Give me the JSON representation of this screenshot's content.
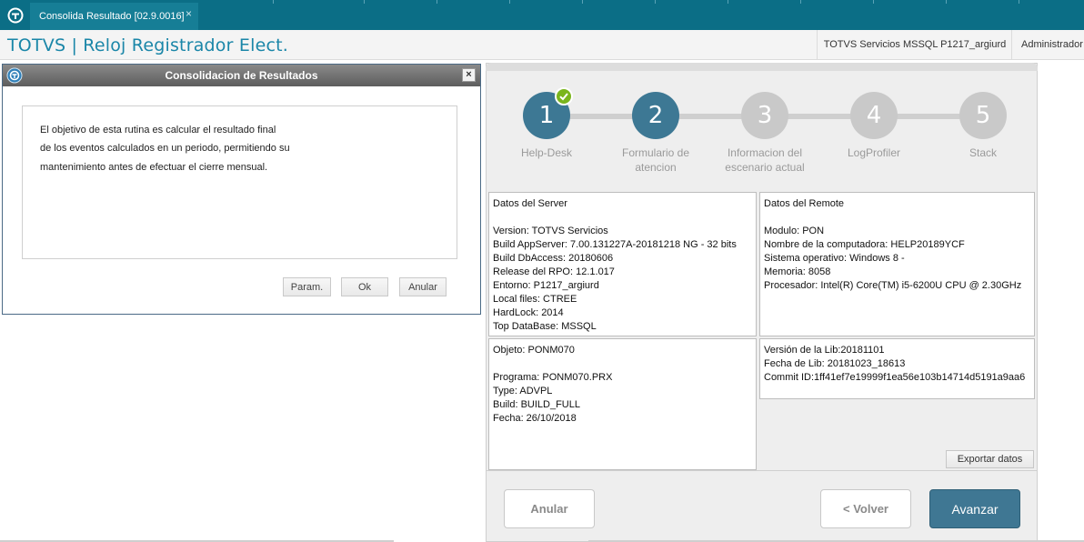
{
  "tab": {
    "title": "Consolida Resultado [02.9.0016]",
    "close": "×"
  },
  "header": {
    "app_title": "TOTVS | Reloj Registrador Elect.",
    "server": "TOTVS Servicios MSSQL P1217_argiurd",
    "user": "Administrador"
  },
  "dialog": {
    "title": "Consolidacion de Resultados",
    "close": "×",
    "lines": [
      "El objetivo de esta rutina es calcular el resultado final",
      "de los eventos calculados en un periodo,  permitiendo su",
      "mantenimiento antes de efectuar el cierre mensual."
    ],
    "buttons": {
      "param": "Param.",
      "ok": "Ok",
      "cancel": "Anular"
    }
  },
  "wizard": {
    "steps": [
      {
        "num": "1",
        "label": "Help-Desk",
        "label2": "",
        "state": "done"
      },
      {
        "num": "2",
        "label": "Formulario de",
        "label2": "atencion",
        "state": "done"
      },
      {
        "num": "3",
        "label": "Informacion del",
        "label2": "escenario actual",
        "state": "todo"
      },
      {
        "num": "4",
        "label": "LogProfiler",
        "label2": "",
        "state": "todo"
      },
      {
        "num": "5",
        "label": "Stack",
        "label2": "",
        "state": "todo"
      }
    ],
    "server": {
      "title": "Datos del Server",
      "lines": [
        "Version: TOTVS Servicios",
        "Build AppServer: 7.00.131227A-20181218 NG - 32 bits",
        "Build DbAccess: 20180606",
        "Release del RPO:  12.1.017",
        "Entorno: P1217_argiurd",
        "Local files: CTREE",
        "HardLock: 2014",
        "Top DataBase: MSSQL"
      ]
    },
    "remote": {
      "title": "Datos del Remote",
      "lines": [
        "Modulo: PON",
        "Nombre de la computadora: HELP20189YCF",
        "Sistema operativo: Windows 8 -",
        "Memoria: 8058",
        "Procesador: Intel(R) Core(TM) i5-6200U CPU @ 2.30GHz"
      ]
    },
    "object": {
      "title": "Objeto: PONM070",
      "lines": [
        "Programa: PONM070.PRX",
        "Type: ADVPL",
        "Build: BUILD_FULL",
        "Fecha: 26/10/2018"
      ]
    },
    "lib": {
      "lines": [
        "Versión de la Lib:20181101",
        "Fecha de Lib: 20181023_18613",
        "Commit ID:1ff41ef7e19999f1ea56e103b14714d5191a9aa6"
      ]
    },
    "export_label": "Exportar datos",
    "buttons": {
      "cancel": "Anular",
      "back": "< Volver",
      "next": "Avanzar"
    }
  },
  "colors": {
    "topbar": "#0b6e86",
    "accent_title": "#1a86a8",
    "step_done": "#3d7894",
    "step_todo": "#c9c9c9",
    "check": "#7ab51d"
  }
}
